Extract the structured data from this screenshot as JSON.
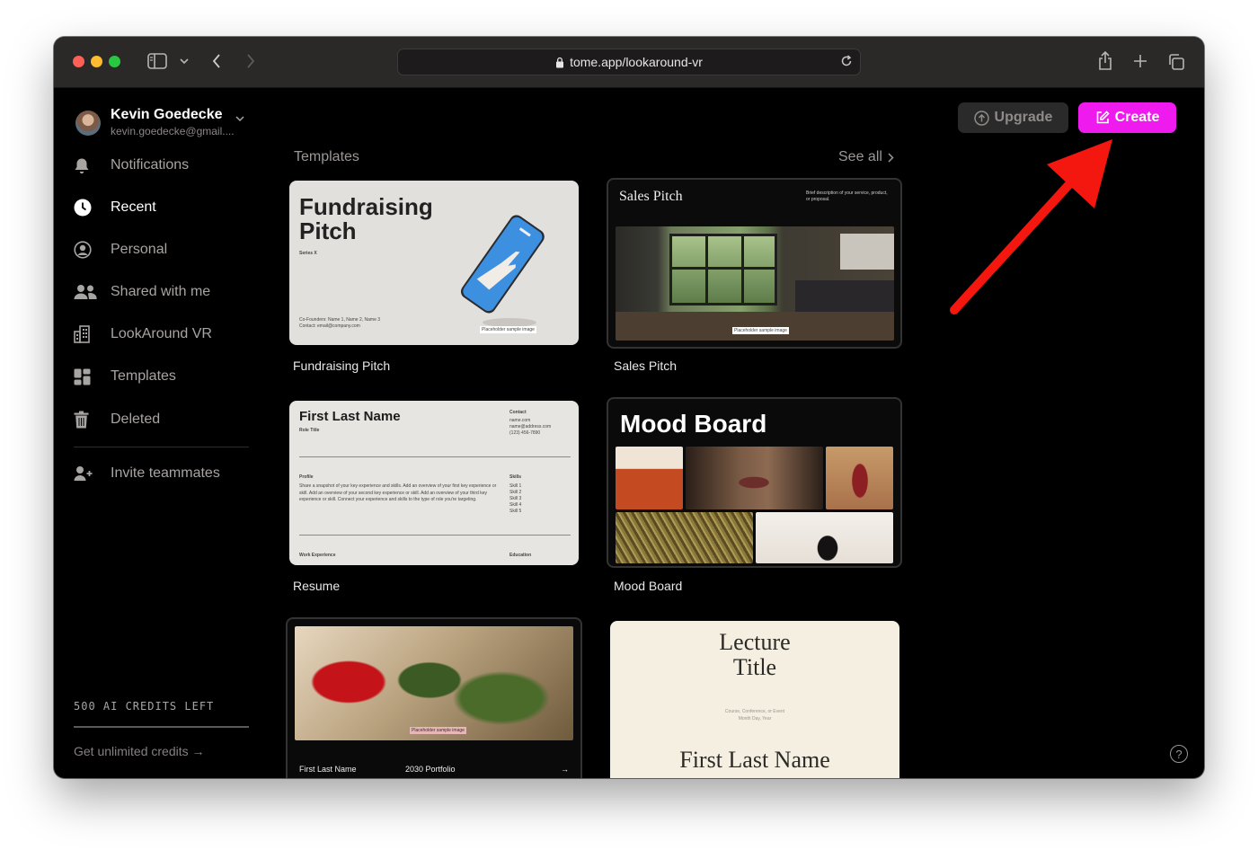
{
  "browser": {
    "url": "tome.app/lookaround-vr",
    "traffic_lights": [
      "#fe5f57",
      "#febc2e",
      "#28c840"
    ]
  },
  "user": {
    "name": "Kevin Goedecke",
    "email": "kevin.goedecke@gmail...."
  },
  "sidebar": {
    "items": [
      {
        "label": "Notifications",
        "icon": "bell-icon"
      },
      {
        "label": "Recent",
        "icon": "clock-icon",
        "active": true
      },
      {
        "label": "Personal",
        "icon": "person-circle-icon"
      },
      {
        "label": "Shared with me",
        "icon": "people-icon"
      },
      {
        "label": "LookAround VR",
        "icon": "building-icon"
      },
      {
        "label": "Templates",
        "icon": "grid-icon"
      },
      {
        "label": "Deleted",
        "icon": "trash-icon"
      }
    ],
    "invite_label": "Invite teammates",
    "credits": "500 AI CREDITS LEFT",
    "unlimited": "Get unlimited credits"
  },
  "header": {
    "upgrade_label": "Upgrade",
    "create_label": "Create",
    "accent": "#ee1aee"
  },
  "templates": {
    "title": "Templates",
    "see_all": "See all",
    "cards": [
      {
        "label": "Fundraising Pitch",
        "title": "Fundraising Pitch",
        "series": "Series X",
        "founders": "Co-Founders: Name 1, Name 2, Name 3",
        "contact": "Contact: email@company.com",
        "placeholder": "Placeholder sample image"
      },
      {
        "label": "Sales Pitch",
        "title": "Sales Pitch",
        "description": "Brief description of your service, product, or proposal.",
        "placeholder": "Placeholder sample image"
      },
      {
        "label": "Resume",
        "name": "First Last Name",
        "role": "Role Title",
        "contact_head": "Contact",
        "contact_lines": [
          "name.com",
          "name@address.com",
          "(123) 456-7890"
        ],
        "profile_head": "Profile",
        "profile_text": "Share a snapshot of your key experience and skills. Add an overview of your first key experience or skill. Add an overview of your second key experience or skill. Add an overview of your third key experience or skill. Connect your experience and skills to the type of role you're targeting.",
        "skills_head": "Skills",
        "skills": [
          "Skill 1",
          "Skill 2",
          "Skill 3",
          "Skill 4",
          "Skill 5"
        ],
        "work_head": "Work Experience",
        "education_head": "Education"
      },
      {
        "label": "Mood Board",
        "title": "Mood Board"
      },
      {
        "label": "",
        "name": "First Last Name",
        "portfolio": "2030 Portfolio",
        "arrow": "→",
        "placeholder": "Placeholder sample image"
      },
      {
        "label": "",
        "title_line1": "Lecture",
        "title_line2": "Title",
        "subtitle": "Course, Conference, or Event",
        "date": "Month Day, Year",
        "name": "First Last Name"
      }
    ]
  },
  "help_label": "?"
}
